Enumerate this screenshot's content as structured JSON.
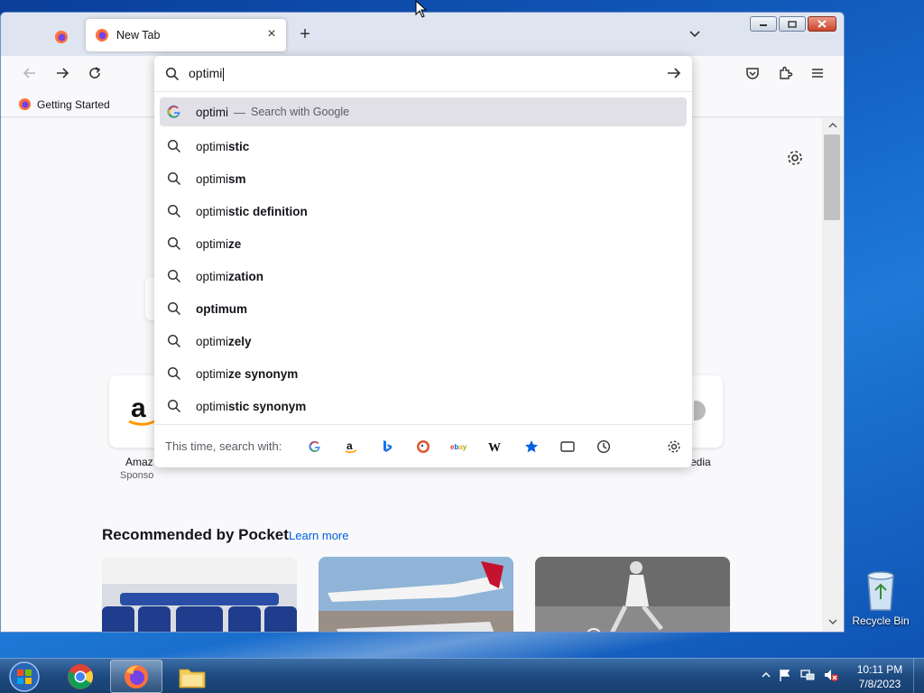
{
  "browser": {
    "tabs": [
      {
        "title": ""
      },
      {
        "title": "New Tab",
        "active": true
      }
    ],
    "new_tab_symbol": "+",
    "close_symbol": "×",
    "bookmarks": [
      {
        "label": "Getting Started"
      }
    ]
  },
  "urlbar": {
    "value": "optimi",
    "heuristic": {
      "typed": "optimi",
      "separator": "—",
      "action": "Search with Google"
    },
    "suggestions": [
      {
        "prefix": "optimi",
        "bold": "stic"
      },
      {
        "prefix": "optimi",
        "bold": "sm"
      },
      {
        "prefix": "optimi",
        "bold": "stic definition"
      },
      {
        "prefix": "optimi",
        "bold": "ze"
      },
      {
        "prefix": "optimi",
        "bold": "zation"
      },
      {
        "prefix": "",
        "bold": "optimum"
      },
      {
        "prefix": "optimi",
        "bold": "zely"
      },
      {
        "prefix": "optimi",
        "bold": "ze synonym"
      },
      {
        "prefix": "optimi",
        "bold": "stic synonym"
      }
    ],
    "oneoff_label": "This time, search with:",
    "engines": [
      "google-icon",
      "amazon-icon",
      "bing-icon",
      "duckduckgo-icon",
      "ebay-icon",
      "wikipedia-icon",
      "bookmarks-icon",
      "tabs-icon",
      "history-icon"
    ]
  },
  "newtab": {
    "shortcuts": [
      {
        "label": "Amaz",
        "sub": "Sponso"
      },
      {
        "label": "edia",
        "sub": ""
      }
    ],
    "pocket": {
      "title": "Recommended by Pocket",
      "learn_more": "Learn more"
    }
  },
  "desktop": {
    "recycle_bin": "Recycle Bin"
  },
  "taskbar": {
    "time": "10:11 PM",
    "date": "7/8/2023"
  },
  "colors": {
    "accent": "#0061e0",
    "taskbar": "#1d4a80"
  }
}
